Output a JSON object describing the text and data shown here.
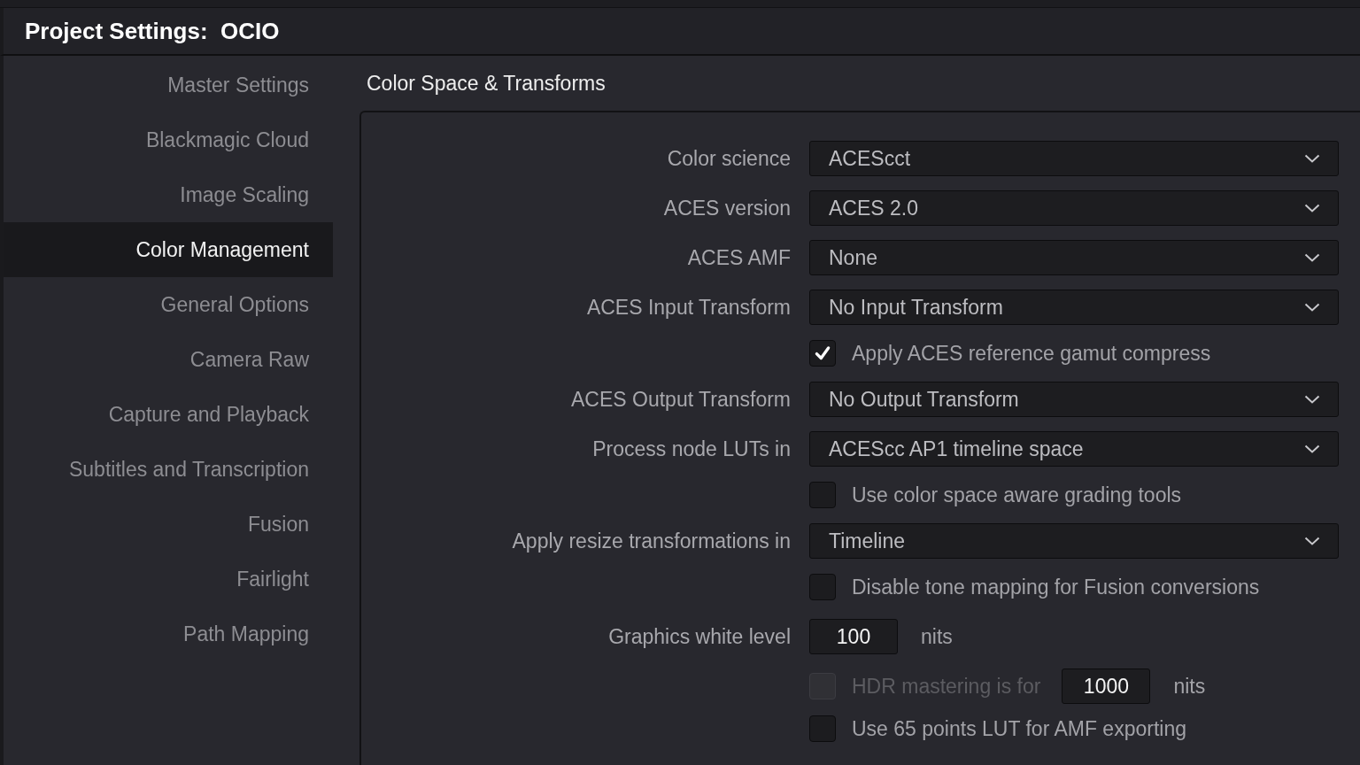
{
  "window": {
    "title": "Project Settings:  OCIO"
  },
  "sidebar": {
    "items": [
      {
        "label": "Master Settings",
        "selected": false
      },
      {
        "label": "Blackmagic Cloud",
        "selected": false
      },
      {
        "label": "Image Scaling",
        "selected": false
      },
      {
        "label": "Color Management",
        "selected": true
      },
      {
        "label": "General Options",
        "selected": false
      },
      {
        "label": "Camera Raw",
        "selected": false
      },
      {
        "label": "Capture and Playback",
        "selected": false
      },
      {
        "label": "Subtitles and Transcription",
        "selected": false
      },
      {
        "label": "Fusion",
        "selected": false
      },
      {
        "label": "Fairlight",
        "selected": false
      },
      {
        "label": "Path Mapping",
        "selected": false
      }
    ]
  },
  "section": {
    "title": "Color Space & Transforms",
    "rows": [
      {
        "kind": "dropdown",
        "label": "Color science",
        "value": "ACEScct"
      },
      {
        "kind": "dropdown",
        "label": "ACES version",
        "value": "ACES 2.0"
      },
      {
        "kind": "dropdown",
        "label": "ACES AMF",
        "value": "None"
      },
      {
        "kind": "dropdown",
        "label": "ACES Input Transform",
        "value": "No Input Transform"
      },
      {
        "kind": "checkbox",
        "label": "Apply ACES reference gamut compress",
        "checked": true,
        "disabled": false
      },
      {
        "kind": "dropdown",
        "label": "ACES Output Transform",
        "value": "No Output Transform"
      },
      {
        "kind": "dropdown",
        "label": "Process node LUTs in",
        "value": "ACEScc AP1 timeline space"
      },
      {
        "kind": "checkbox",
        "label": "Use color space aware grading tools",
        "checked": false,
        "disabled": false
      },
      {
        "kind": "dropdown",
        "label": "Apply resize transformations in",
        "value": "Timeline"
      },
      {
        "kind": "checkbox",
        "label": "Disable tone mapping for Fusion conversions",
        "checked": false,
        "disabled": false
      },
      {
        "kind": "number",
        "label": "Graphics white level",
        "value": "100",
        "unit": "nits"
      },
      {
        "kind": "checkbox_number",
        "label": "HDR mastering is for",
        "checked": false,
        "disabled": true,
        "value": "1000",
        "unit": "nits"
      },
      {
        "kind": "checkbox",
        "label": "Use 65 points LUT for AMF exporting",
        "checked": false,
        "disabled": false
      }
    ]
  }
}
